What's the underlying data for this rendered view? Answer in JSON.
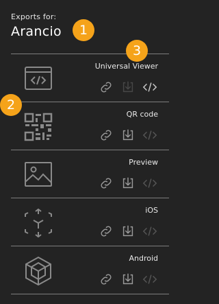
{
  "header": {
    "label": "Exports for:",
    "name": "Arancio"
  },
  "badges": [
    "1",
    "2",
    "3"
  ],
  "rows": [
    {
      "title": "Universal Viewer",
      "thumb": "code-window-icon",
      "link": "active",
      "download": "disabled",
      "embed": "active"
    },
    {
      "title": "QR code",
      "thumb": "qr-code-icon",
      "link": "active",
      "download": "active",
      "embed": "disabled"
    },
    {
      "title": "Preview",
      "thumb": "image-icon",
      "link": "active",
      "download": "active",
      "embed": "disabled"
    },
    {
      "title": "iOS",
      "thumb": "ar-cube-icon",
      "link": "active",
      "download": "active",
      "embed": "disabled"
    },
    {
      "title": "Android",
      "thumb": "android-cube-icon",
      "link": "active",
      "download": "active",
      "embed": "disabled"
    }
  ],
  "colors": {
    "background": "#232323",
    "badge": "#f5a31a",
    "divider": "#7e7e7e"
  }
}
